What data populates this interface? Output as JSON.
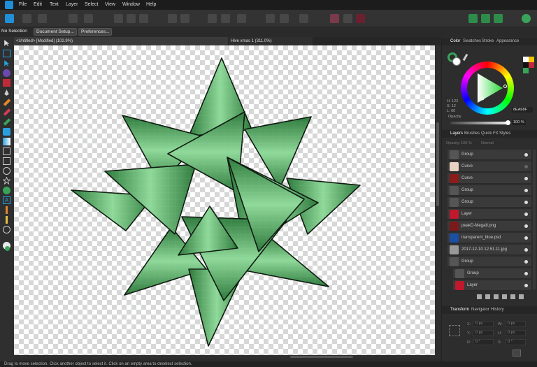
{
  "menu": [
    "File",
    "Edit",
    "Text",
    "Layer",
    "Select",
    "View",
    "Window",
    "Help"
  ],
  "context": {
    "selection": "No Selection",
    "doc_setup": "Document Setup...",
    "preferences": "Preferences..."
  },
  "tabs": [
    "<Untitled> [Modified] (102.9%)",
    "Hive xmas 1 (311.0%)"
  ],
  "color_panel": {
    "tabs": [
      "Color",
      "Swatches",
      "Stroke",
      "Appearance"
    ],
    "h": "H: 123",
    "s": "S: 12",
    "l": "L: 60",
    "hex": "8EA68F",
    "opacity_label": "Opacity",
    "opacity_value": "100 %"
  },
  "layers_panel": {
    "tabs": [
      "Layers",
      "Brushes",
      "Quick FX",
      "Styles"
    ],
    "opacity_label": "Opacity:",
    "opacity_value": "100 %",
    "blend": "Normal",
    "rows": [
      {
        "name": "Group",
        "thumb": "#555"
      },
      {
        "name": "Curve",
        "thumb": "#e8d2c4"
      },
      {
        "name": "Curve",
        "thumb": "#8a1c1c"
      },
      {
        "name": "Group",
        "thumb": "#555"
      },
      {
        "name": "Group",
        "thumb": "#555"
      },
      {
        "name": "Layer",
        "thumb": "#c0182c"
      },
      {
        "name": "peakD-Mega8.png",
        "thumb": "#7a1a1a"
      },
      {
        "name": "transparent_blue.psd",
        "thumb": "#1b4fa3"
      },
      {
        "name": "2017-12-10 12.51.11.jpg",
        "thumb": "#999"
      },
      {
        "name": "Group",
        "thumb": "#555"
      },
      {
        "name": "Group",
        "thumb": "#555"
      },
      {
        "name": "Layer",
        "thumb": "#c0182c"
      }
    ]
  },
  "transform_panel": {
    "tabs": [
      "Transform",
      "Navigator",
      "History"
    ],
    "x_label": "X:",
    "x_value": "0 px",
    "y_label": "Y:",
    "y_value": "0 px",
    "w_label": "W:",
    "w_value": "0 px",
    "h_label": "H:",
    "h_value": "0 px",
    "r_label": "R:",
    "r_value": "0 °",
    "s_label": "S:",
    "s_value": "0 °"
  },
  "status": {
    "text": "Drag to move selection. Click another object to select it. Click on an empty area to deselect selection."
  },
  "colors": {
    "accent": "#1f8fd8",
    "bow_dark": "#2e7a3c",
    "bow_light": "#8fd99a"
  }
}
